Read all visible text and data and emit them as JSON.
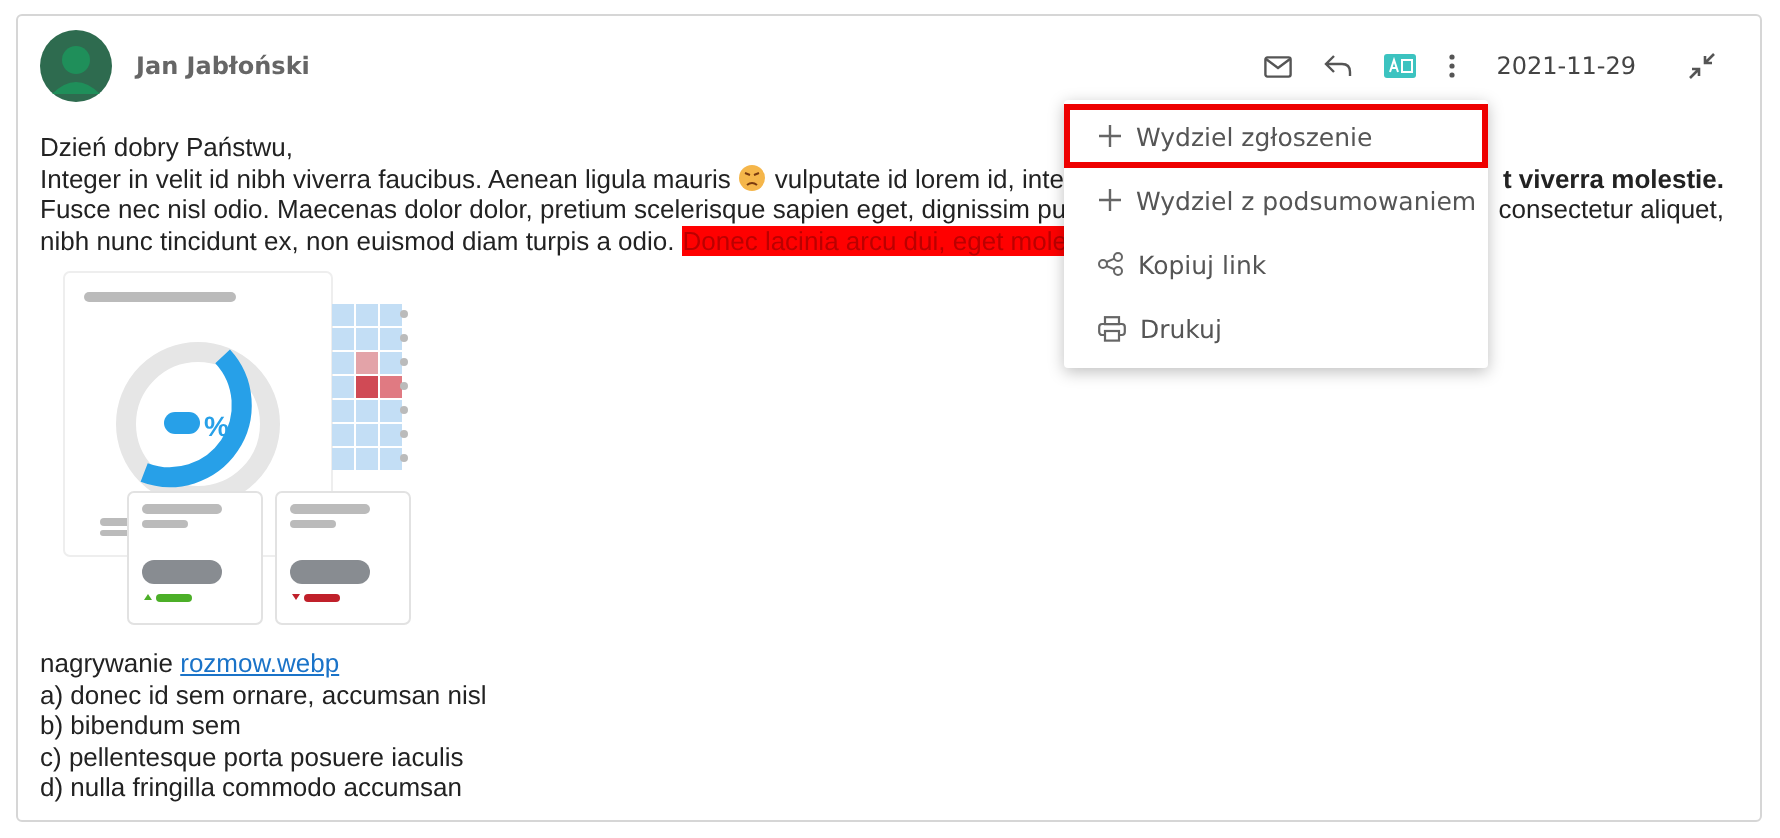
{
  "message": {
    "sender": "Jan Jabłoński",
    "date": "2021-11-29",
    "greeting": "Dzień dobry Państwu,",
    "lines": [
      {
        "left": [
          "Integer in velit id nibh viverra faucibus. Aenean ligula mauris",
          "vulputate id lorem id, inte"
        ],
        "right": "**t viverra molestie.**"
      },
      {
        "left": [
          "Fusce nec nisl odio. Maecenas dolor dolor, pretium scelerisque sapien eget, dignissim pu"
        ],
        "right": "consectetur aliquet,"
      },
      {
        "left": [
          "nibh nunc tincidunt ex, non euismod diam turpis a odio."
        ],
        "highlight": "Donec lacinia arcu dui, eget mole"
      }
    ],
    "illustration_symbol": "%",
    "attachment_label": "nagrywanie",
    "attachment_link": "rozmow.webp",
    "list": [
      "a) donec id sem ornare, accumsan nisl",
      "b) bibendum sem",
      "c) pellentesque porta posuere iaculis",
      "d) nulla fringilla commodo accumsan"
    ]
  },
  "menu": [
    {
      "kind": "plus",
      "label": "Wydziel zgłoszenie",
      "selected": true
    },
    {
      "kind": "plus",
      "label": "Wydziel z podsumowaniem",
      "selected": false
    },
    {
      "kind": "share",
      "label": "Kopiuj link",
      "selected": false
    },
    {
      "kind": "print",
      "label": "Drukuj",
      "selected": false
    }
  ]
}
